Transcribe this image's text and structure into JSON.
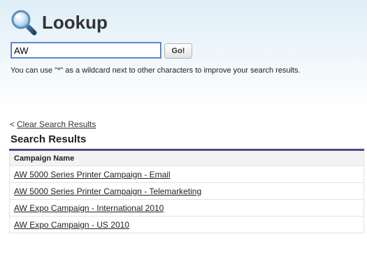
{
  "header": {
    "title": "Lookup",
    "icon": "magnifier-icon"
  },
  "search": {
    "value": "AW",
    "go_label": "Go!",
    "hint": "You can use \"*\" as a wildcard next to other characters to improve your search results."
  },
  "results": {
    "clear_prefix": "<",
    "clear_label": "Clear Search Results",
    "title": "Search Results",
    "column_header": "Campaign Name",
    "rows": [
      "AW 5000 Series Printer Campaign - Email",
      "AW 5000 Series Printer Campaign - Telemarketing",
      "AW Expo Campaign - International 2010",
      "AW Expo Campaign - US 2010"
    ]
  },
  "colors": {
    "header_bg": "#e0eef7",
    "table_accent": "#56458c",
    "input_focus": "#3b6ee0"
  }
}
